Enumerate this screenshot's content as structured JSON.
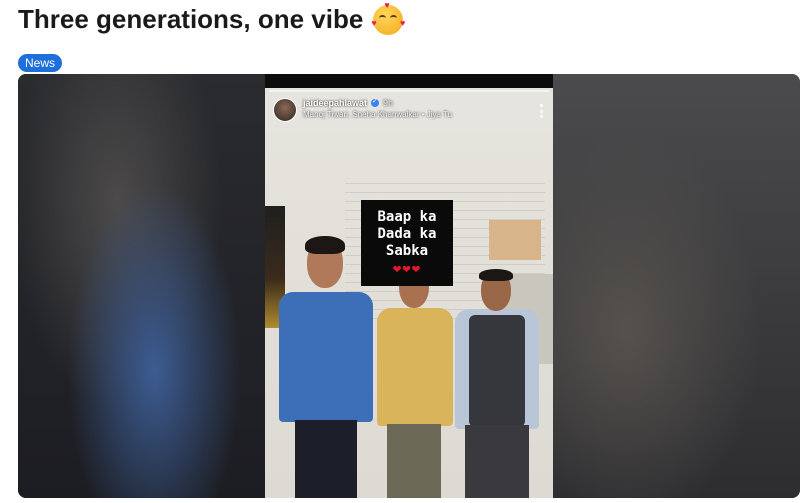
{
  "post": {
    "title": "Three generations, one vibe",
    "title_emoji": "smiling-face-with-hearts-emoji",
    "tag": "News"
  },
  "story": {
    "username": "jaideepahlawat",
    "time": "9h",
    "collaborators": "Manoj Tiwari, Sneha Khanwalkar • Jiya Tu",
    "caption_lines": [
      "Baap ka",
      "Dada ka",
      "Sabka"
    ],
    "caption_hearts": "❤❤❤",
    "colors": {
      "caption_bg": "#0a0a0a",
      "heart": "#e0192b",
      "tag_bg": "#1e6fd9"
    }
  }
}
